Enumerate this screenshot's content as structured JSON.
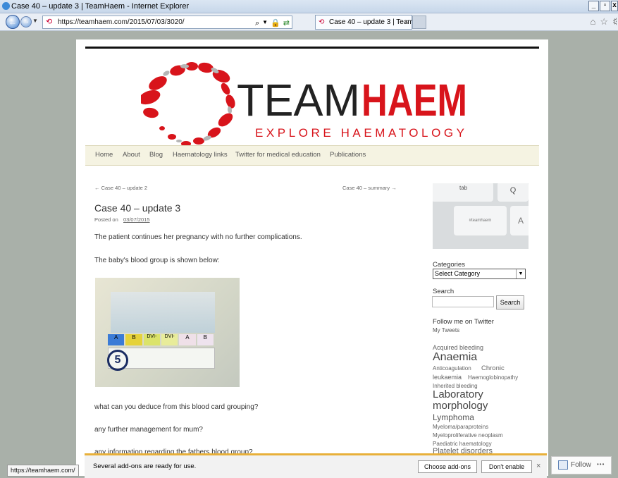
{
  "window": {
    "title": "Case 40 – update 3 | TeamHaem - Internet Explorer",
    "controls": [
      "_",
      "▫",
      "x"
    ]
  },
  "browser": {
    "url": "https://teamhaem.com/2015/07/03/3020/",
    "tab_title": "Case 40 – update 3 | Team...",
    "tab_close": "×"
  },
  "header": {
    "logo_team": "TEAM",
    "logo_haem": "HAEM",
    "tagline": "EXPLORE HAEMATOLOGY",
    "colors": {
      "accent": "#d8141b",
      "dark": "#222222"
    }
  },
  "nav": {
    "items": [
      "Home",
      "About",
      "Blog",
      "Haematology links",
      "Twitter for medical education",
      "Publications"
    ]
  },
  "post": {
    "prev_link": "← Case 40 – update 2",
    "next_link": "Case 40 – summary →",
    "title": "Case 40 – update 3",
    "posted_on_label": "Posted on",
    "date": "03/07/2015",
    "paragraphs": [
      "The patient continues her pregnancy with no further complications.",
      "The baby's blood group is shown below:"
    ],
    "card_labels": [
      "A",
      "B",
      "DVI-",
      "DVI-",
      "A",
      "B"
    ],
    "card_number": "5",
    "questions": [
      "what can you deduce from this blood card grouping?",
      "any further management for mum?",
      "any information regarding the fathers blood group?"
    ]
  },
  "sidebar": {
    "image_keys": {
      "tab": "tab",
      "q": "Q",
      "hashtag": "#teamhaem",
      "a": "A"
    },
    "categories_label": "Categories",
    "categories_select": "Select Category",
    "search_label": "Search",
    "search_button": "Search",
    "follow_label": "Follow me on Twitter",
    "my_tweets": "My Tweets",
    "tags": [
      "Acquired bleeding",
      "Anaemia",
      "Anticoagulation",
      "Chronic",
      "leukaemia",
      "Haemoglobinopathy",
      "Inherited bleeding",
      "Laboratory",
      "morphology",
      "Lymphoma",
      "Myeloma/paraproteins",
      "Myeloproliferative neoplasm",
      "Paediatric haematology",
      "Platelet disorders"
    ]
  },
  "notification": {
    "message": "Several add-ons are ready for use.",
    "choose": "Choose add-ons",
    "dont": "Don't enable",
    "close": "×"
  },
  "status_url": "https://teamhaem.com/",
  "follow": {
    "label": "Follow",
    "more": "•••"
  }
}
